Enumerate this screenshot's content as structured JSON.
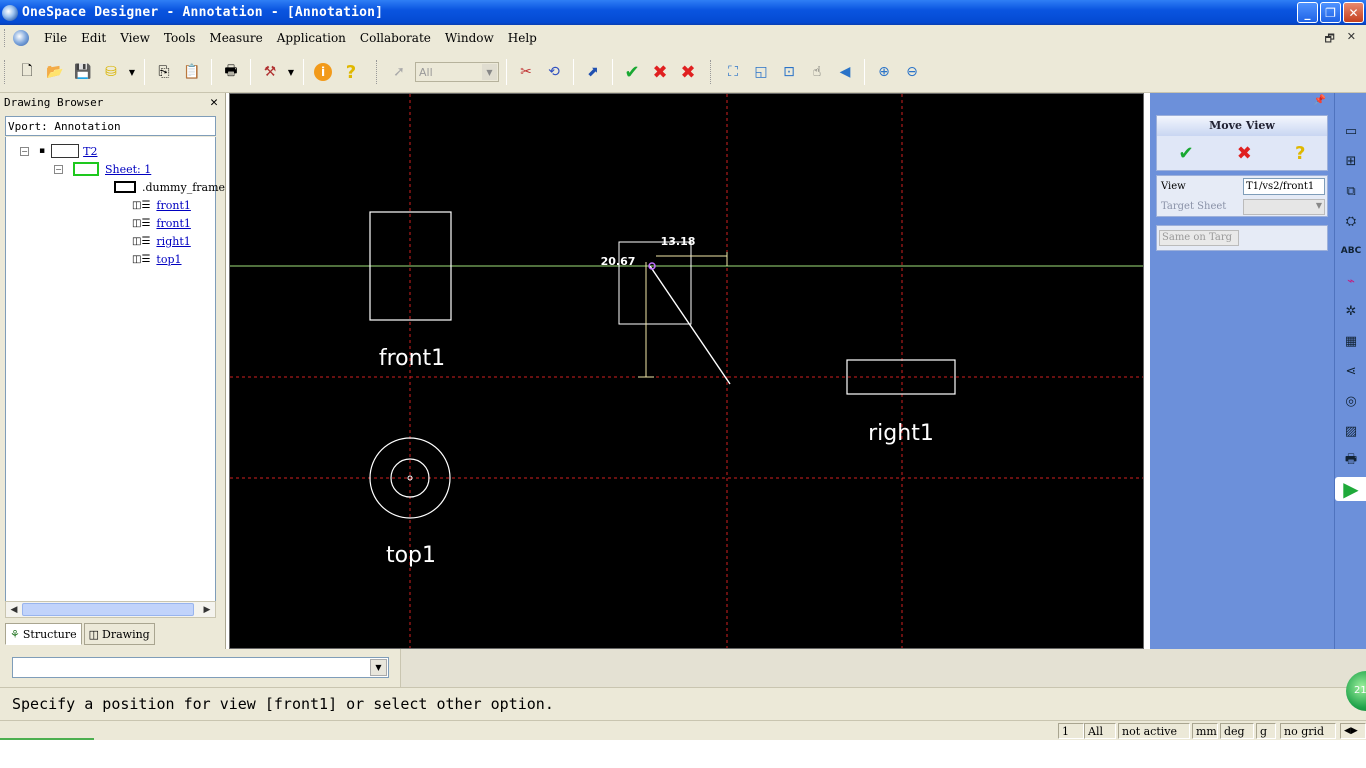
{
  "window": {
    "title": "OneSpace Designer - Annotation - [Annotation]",
    "minimize": "_",
    "restore": "❐",
    "close": "✕"
  },
  "menu": {
    "items": [
      "File",
      "Edit",
      "View",
      "Tools",
      "Measure",
      "Application",
      "Collaborate",
      "Window",
      "Help"
    ],
    "mdi_restore": "🗗",
    "mdi_close": "✕"
  },
  "toolbar": {
    "select_filter": "All",
    "icons": [
      "new-icon",
      "open-icon",
      "save-icon",
      "database-icon",
      "copy-icon",
      "paste-icon",
      "print-icon",
      "hammer-icon",
      "info-icon",
      "help-icon",
      "pointer-icon",
      "delete-icon",
      "cancel-icon",
      "move-icon",
      "ok-icon",
      "stop-icon",
      "stop-all-icon",
      "fit-icon",
      "window-icon",
      "zoom-box-icon",
      "pan-icon",
      "prev-view-icon",
      "zoom-in-icon",
      "zoom-out-icon"
    ]
  },
  "browser": {
    "title": "Drawing Browser",
    "vport": "Vport: Annotation",
    "tree": {
      "root": "T2",
      "sheet": "Sheet: 1",
      "frame": ".dummy_frame",
      "views": [
        "front1",
        "front1",
        "right1",
        "top1"
      ]
    },
    "tabs": [
      "Structure",
      "Drawing"
    ]
  },
  "canvas": {
    "views": {
      "front": "front1",
      "right": "right1",
      "top": "top1"
    },
    "dimensions": {
      "horizontal": "13.18",
      "vertical": "20.67"
    },
    "colors": {
      "background": "#000000",
      "geometry": "#ffffff",
      "centerline": "#d02020",
      "guide": "#9fe07a",
      "dimension": "#f2e8a8"
    }
  },
  "move_view_panel": {
    "title": "Move View",
    "view_label": "View",
    "view_value": "T1/vs2/front1",
    "target_sheet_label": "Target Sheet",
    "same_button": "Same on Targ"
  },
  "command": {
    "prompt": "Specify a position for view [front1] or select other option."
  },
  "status": {
    "page": "1",
    "filter": "All",
    "active": "not active",
    "length_unit": "mm",
    "angle_unit": "deg",
    "mass_unit": "g",
    "grid": "no grid"
  },
  "orb_label": "21"
}
